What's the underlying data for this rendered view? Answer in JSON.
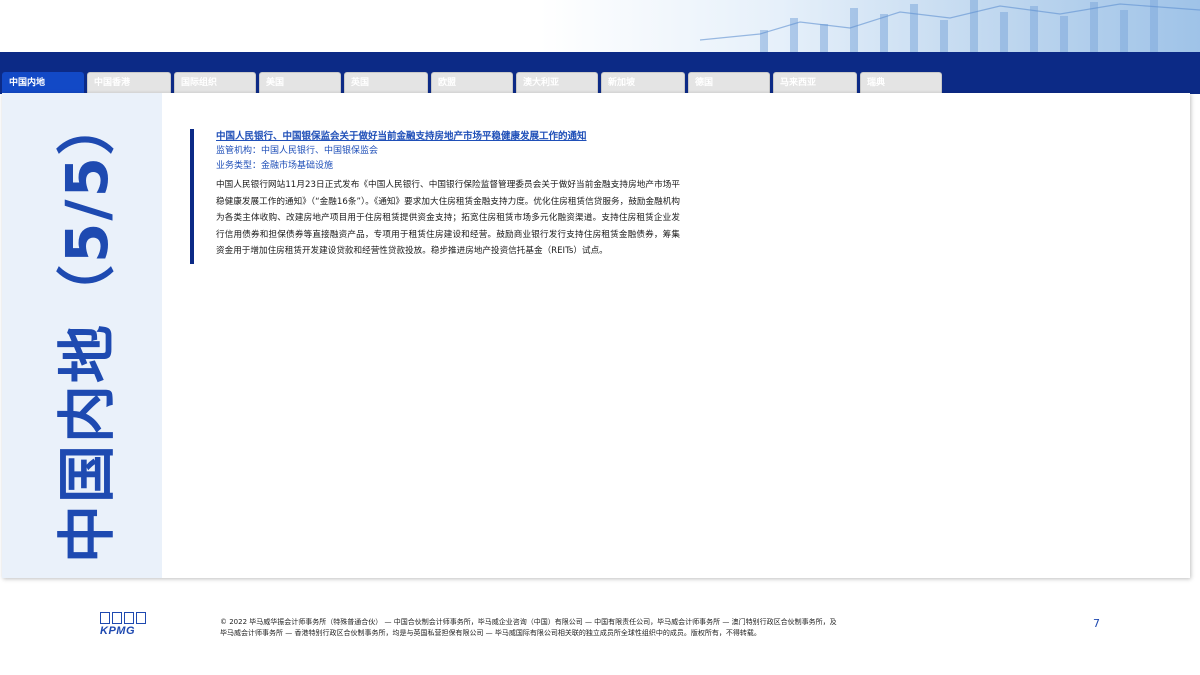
{
  "tabs": [
    {
      "label": "中国内地",
      "active": true
    },
    {
      "label": "中国香港",
      "active": false
    },
    {
      "label": "国际组织",
      "active": false
    },
    {
      "label": "美国",
      "active": false
    },
    {
      "label": "英国",
      "active": false
    },
    {
      "label": "欧盟",
      "active": false
    },
    {
      "label": "澳大利亚",
      "active": false
    },
    {
      "label": "新加坡",
      "active": false
    },
    {
      "label": "德国",
      "active": false
    },
    {
      "label": "马来西亚",
      "active": false
    },
    {
      "label": "瑞典",
      "active": false
    }
  ],
  "side_title": "中国内地（5/5）",
  "article": {
    "headline": "中国人民银行、中国银保监会关于做好当前金融支持房地产市场平稳健康发展工作的通知",
    "regulator": "监管机构：中国人民银行、中国银保监会",
    "business_type": "业务类型：金融市场基础设施",
    "body": "中国人民银行网站11月23日正式发布《中国人民银行、中国银行保险监督管理委员会关于做好当前金融支持房地产市场平稳健康发展工作的通知》（“金融16条”）。《通知》要求加大住房租赁金融支持力度。优化住房租赁信贷服务，鼓励金融机构为各类主体收购、改建房地产项目用于住房租赁提供资金支持；拓宽住房租赁市场多元化融资渠道。支持住房租赁企业发行信用债券和担保债券等直接融资产品，专项用于租赁住房建设和经营。鼓励商业银行发行支持住房租赁金融债券，筹集资金用于增加住房租赁开发建设贷款和经营性贷款投放。稳步推进房地产投资信托基金（REITs）试点。"
  },
  "footer": {
    "logo_text": "KPMG",
    "legal_line1": "© 2022 毕马威华振会计师事务所（特殊普通合伙） — 中国合伙制会计师事务所，毕马威企业咨询（中国）有限公司 — 中国有限责任公司，毕马威会计师事务所 — 澳门特别行政区合伙制事务所，及",
    "legal_line2": "毕马威会计师事务所 — 香港特别行政区合伙制事务所，均是与英国私营担保有限公司 — 毕马威国际有限公司相关联的独立成员所全球性组织中的成员。版权所有，不得转载。",
    "page_number": "7"
  },
  "colors": {
    "navy": "#0c2a86",
    "accent_blue": "#1e4ab1",
    "active_tab": "#1249c6",
    "side_panel": "#eaf1fa"
  }
}
